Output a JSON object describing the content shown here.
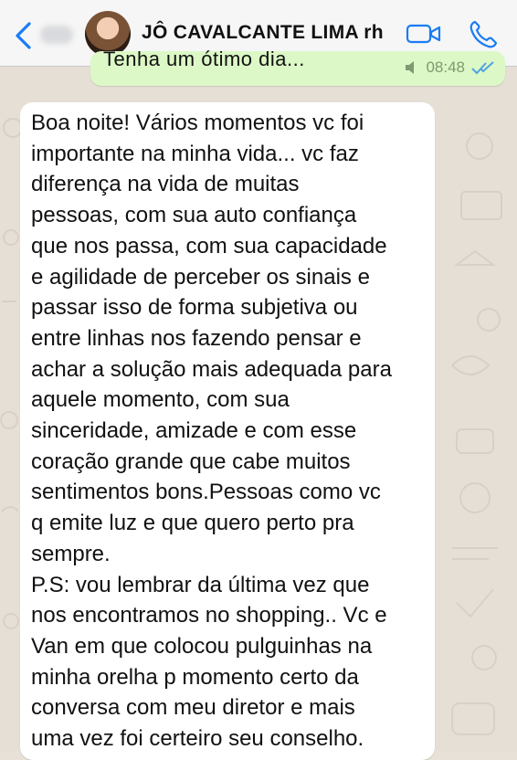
{
  "header": {
    "contact_name": "JÔ CAVALCANTE LIMA rh",
    "icons": {
      "back": "chevron-left-icon",
      "video": "video-camera-icon",
      "call": "phone-icon"
    },
    "accent_color": "#1a7cf5"
  },
  "outgoing": {
    "text": "Tenha um ótimo dia...",
    "time": "08:48",
    "status": "read"
  },
  "incoming": {
    "lines": [
      "Boa noite! Vários momentos vc foi",
      "importante na minha vida... vc faz",
      "diferença na vida de muitas",
      "pessoas, com sua auto confiança",
      "que nos passa, com sua capacidade",
      "e agilidade de perceber os sinais e",
      "passar isso de forma subjetiva ou",
      "entre linhas nos fazendo pensar e",
      "achar a solução mais adequada para",
      "aquele momento, com sua",
      "sinceridade, amizade e com esse",
      "coração grande que cabe muitos",
      "sentimentos bons.Pessoas como vc",
      "q emite luz e que quero perto pra",
      "sempre.",
      "P.S: vou lembrar da última vez que",
      "nos encontramos no shopping.. Vc e",
      "Van em que colocou pulguinhas na",
      "minha orelha p momento certo da",
      "conversa com meu diretor e mais",
      "uma vez foi certeiro seu conselho."
    ]
  },
  "colors": {
    "outgoing_bubble": "#dcf8c6",
    "incoming_bubble": "#ffffff",
    "read_ticks": "#4fa3e0",
    "chat_background": "#e6dfd6"
  }
}
